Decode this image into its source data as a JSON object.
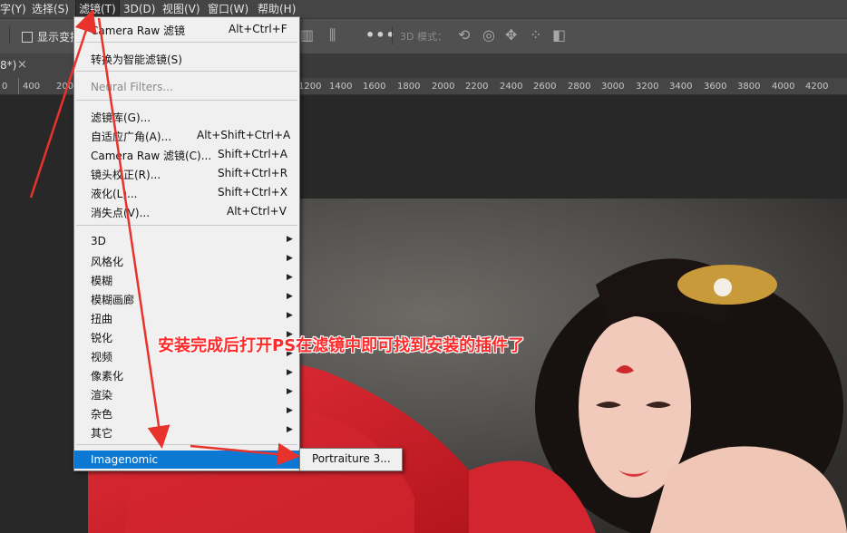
{
  "menubar": {
    "items": [
      {
        "label": "字(Y)"
      },
      {
        "label": "选择(S)"
      },
      {
        "label": "滤镜(T)",
        "active": true
      },
      {
        "label": "3D(D)"
      },
      {
        "label": "视图(V)"
      },
      {
        "label": "窗口(W)"
      },
      {
        "label": "帮助(H)"
      }
    ]
  },
  "options_bar": {
    "show_transform_label": "显示变换",
    "three_d_mode_label": "3D 模式："
  },
  "document_tab": {
    "title": "8*)",
    "close": "×"
  },
  "ruler": {
    "labels": [
      "0",
      "400",
      "200",
      "1200",
      "1400",
      "1600",
      "1800",
      "2000",
      "2200",
      "2400",
      "2600",
      "2800",
      "3000",
      "3200",
      "3400",
      "3600",
      "3800",
      "4000",
      "4200"
    ]
  },
  "filter_menu": {
    "items": [
      {
        "label": "Camera Raw 滤镜",
        "shortcut": "Alt+Ctrl+F"
      },
      {
        "label": "转换为智能滤镜(S)",
        "shortcut": ""
      },
      {
        "label": "Neural Filters...",
        "shortcut": "",
        "disabled": true
      },
      {
        "label": "滤镜库(G)...",
        "shortcut": ""
      },
      {
        "label": "自适应广角(A)...",
        "shortcut": "Alt+Shift+Ctrl+A"
      },
      {
        "label": "Camera Raw 滤镜(C)...",
        "shortcut": "Shift+Ctrl+A"
      },
      {
        "label": "镜头校正(R)...",
        "shortcut": "Shift+Ctrl+R"
      },
      {
        "label": "液化(L)...",
        "shortcut": "Shift+Ctrl+X"
      },
      {
        "label": "消失点(V)...",
        "shortcut": "Alt+Ctrl+V"
      },
      {
        "label": "3D",
        "submenu": true
      },
      {
        "label": "风格化",
        "submenu": true
      },
      {
        "label": "模糊",
        "submenu": true
      },
      {
        "label": "模糊画廊",
        "submenu": true
      },
      {
        "label": "扭曲",
        "submenu": true
      },
      {
        "label": "锐化",
        "submenu": true
      },
      {
        "label": "视频",
        "submenu": true
      },
      {
        "label": "像素化",
        "submenu": true
      },
      {
        "label": "渲染",
        "submenu": true
      },
      {
        "label": "杂色",
        "submenu": true
      },
      {
        "label": "其它",
        "submenu": true
      },
      {
        "label": "Imagenomic",
        "submenu": true,
        "highlighted": true
      }
    ]
  },
  "submenu": {
    "items": [
      {
        "label": "Portraiture 3..."
      }
    ]
  },
  "annotation": {
    "text": "安装完成后打开PS在滤镜中即可找到安装的插件了",
    "color": "#ff2a2a"
  },
  "colors": {
    "accent": "#0b78d4",
    "arrow": "#e8322c"
  }
}
